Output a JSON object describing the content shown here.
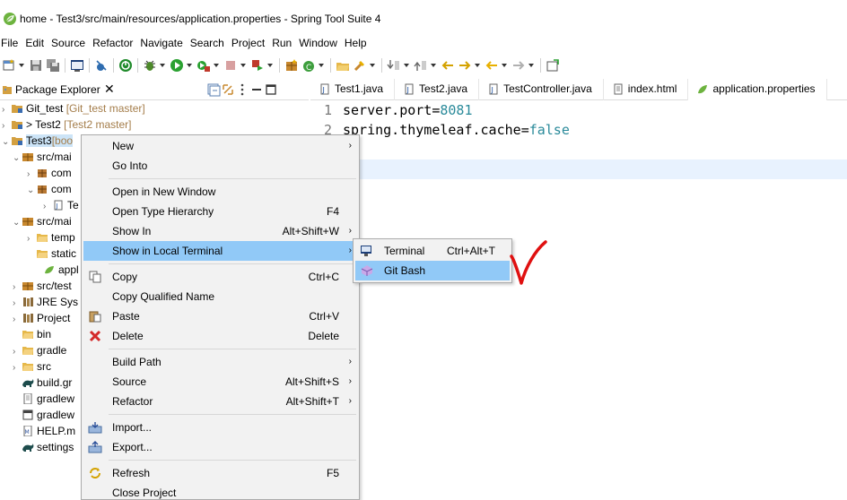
{
  "window": {
    "title": "home - Test3/src/main/resources/application.properties - Spring Tool Suite 4"
  },
  "menubar": [
    "File",
    "Edit",
    "Source",
    "Refactor",
    "Navigate",
    "Search",
    "Project",
    "Run",
    "Window",
    "Help"
  ],
  "package_explorer": {
    "tab_label": "Package Explorer",
    "close_glyph": "✕",
    "tree": [
      {
        "name": "Git_test",
        "suffix": "[Git_test master]"
      },
      {
        "name": "> Test2",
        "suffix": "[Test2 master]"
      },
      {
        "name": "Test3",
        "suffix": "[boo"
      },
      {
        "name": "src/mai"
      },
      {
        "name": "com"
      },
      {
        "name": "com"
      },
      {
        "name": "Te"
      },
      {
        "name": "src/mai"
      },
      {
        "name": "temp"
      },
      {
        "name": "static"
      },
      {
        "name": "appl"
      },
      {
        "name": "src/test"
      },
      {
        "name": "JRE Sys"
      },
      {
        "name": "Project"
      },
      {
        "name": "bin"
      },
      {
        "name": "gradle"
      },
      {
        "name": "src"
      },
      {
        "name": "build.gr"
      },
      {
        "name": "gradlew"
      },
      {
        "name": "gradlew"
      },
      {
        "name": "HELP.m"
      },
      {
        "name": "settings"
      }
    ]
  },
  "editor": {
    "tabs": [
      "Test1.java",
      "Test2.java",
      "TestController.java",
      "index.html",
      "application.properties"
    ],
    "lines": [
      {
        "num": "1",
        "key": "server.port",
        "op": "=",
        "value": "8081"
      },
      {
        "num": "2",
        "key": "spring.thymeleaf.cache",
        "op": "=",
        "value": "false"
      }
    ]
  },
  "context_menu": {
    "items": [
      {
        "label": "New",
        "shortcut": "",
        "arrow": "›"
      },
      {
        "label": "Go Into",
        "shortcut": "",
        "arrow": ""
      },
      {
        "label": "Open in New Window",
        "shortcut": "",
        "arrow": ""
      },
      {
        "label": "Open Type Hierarchy",
        "shortcut": "F4",
        "arrow": ""
      },
      {
        "label": "Show In",
        "shortcut": "Alt+Shift+W",
        "arrow": "›"
      },
      {
        "label": "Show in Local Terminal",
        "shortcut": "",
        "arrow": "›"
      },
      {
        "label": "Copy",
        "shortcut": "Ctrl+C",
        "arrow": ""
      },
      {
        "label": "Copy Qualified Name",
        "shortcut": "",
        "arrow": ""
      },
      {
        "label": "Paste",
        "shortcut": "Ctrl+V",
        "arrow": ""
      },
      {
        "label": "Delete",
        "shortcut": "Delete",
        "arrow": ""
      },
      {
        "label": "Build Path",
        "shortcut": "",
        "arrow": "›"
      },
      {
        "label": "Source",
        "shortcut": "Alt+Shift+S",
        "arrow": "›"
      },
      {
        "label": "Refactor",
        "shortcut": "Alt+Shift+T",
        "arrow": "›"
      },
      {
        "label": "Import...",
        "shortcut": "",
        "arrow": ""
      },
      {
        "label": "Export...",
        "shortcut": "",
        "arrow": ""
      },
      {
        "label": "Refresh",
        "shortcut": "F5",
        "arrow": ""
      },
      {
        "label": "Close Project",
        "shortcut": "",
        "arrow": ""
      }
    ]
  },
  "submenu": {
    "items": [
      {
        "label": "Terminal",
        "shortcut": "Ctrl+Alt+T"
      },
      {
        "label": "Git Bash",
        "shortcut": ""
      }
    ]
  },
  "colors": {
    "highlight": "#91c9f7",
    "annotation": "#e01010",
    "value": "#2a8a9a"
  }
}
